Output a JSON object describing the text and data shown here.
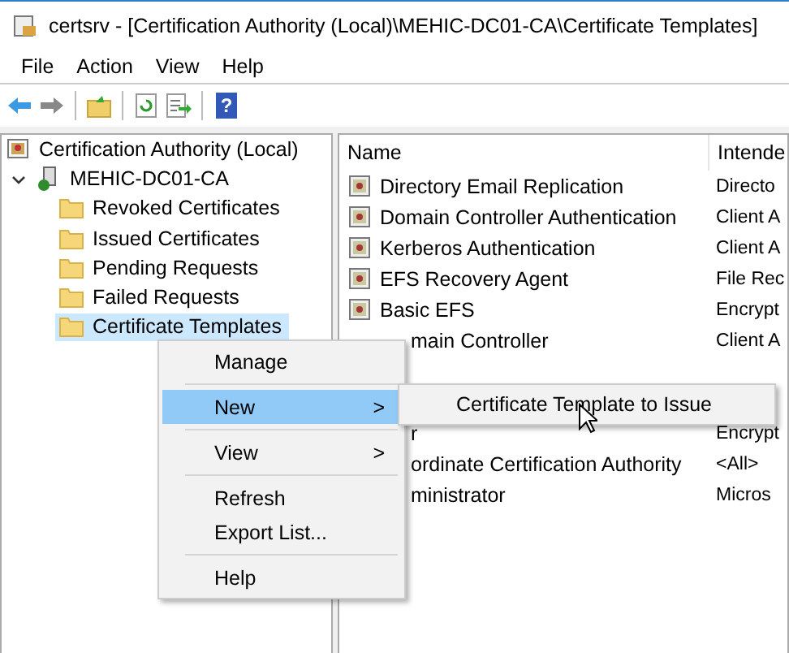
{
  "window": {
    "title": "certsrv - [Certification Authority (Local)\\MEHIC-DC01-CA\\Certificate Templates]"
  },
  "menu_bar": [
    "File",
    "Action",
    "View",
    "Help"
  ],
  "toolbar": {
    "help_glyph": "?"
  },
  "tree": [
    {
      "label": "Certification Authority (Local)",
      "kind": "root",
      "selected": false,
      "children": [
        {
          "label": "MEHIC-DC01-CA",
          "kind": "server",
          "selected": false,
          "expanded": true,
          "children": [
            {
              "label": "Revoked Certificates",
              "kind": "folder",
              "selected": false
            },
            {
              "label": "Issued Certificates",
              "kind": "folder",
              "selected": false
            },
            {
              "label": "Pending Requests",
              "kind": "folder",
              "selected": false
            },
            {
              "label": "Failed Requests",
              "kind": "folder",
              "selected": false
            },
            {
              "label": "Certificate Templates",
              "kind": "folder",
              "selected": true
            }
          ]
        }
      ]
    }
  ],
  "list": {
    "columns": [
      "Name",
      "Intende"
    ],
    "rows": [
      {
        "kind": "full",
        "name": "Directory Email Replication",
        "intended": "Directo"
      },
      {
        "kind": "full",
        "name": "Domain Controller Authentication",
        "intended": "Client A"
      },
      {
        "kind": "full",
        "name": "Kerberos Authentication",
        "intended": "Client A"
      },
      {
        "kind": "full",
        "name": "EFS Recovery Agent",
        "intended": "File Rec"
      },
      {
        "kind": "full",
        "name": "Basic EFS",
        "intended": "Encrypt"
      },
      {
        "kind": "covered",
        "name": "main Controller",
        "intended": "Client A"
      },
      {
        "kind": "gap"
      },
      {
        "kind": "gap"
      },
      {
        "kind": "covered",
        "name": "r",
        "intended": "Encrypt"
      },
      {
        "kind": "covered",
        "name": "ordinate Certification Authority",
        "intended": "<All>"
      },
      {
        "kind": "covered",
        "name": "ministrator",
        "intended": "Micros"
      }
    ]
  },
  "context_menu": {
    "items": [
      {
        "kind": "item",
        "label": "Manage",
        "selected": false,
        "submenu": false
      },
      {
        "kind": "separator"
      },
      {
        "kind": "item",
        "label": "New",
        "selected": true,
        "submenu": true,
        "arrow": ">"
      },
      {
        "kind": "separator"
      },
      {
        "kind": "item",
        "label": "View",
        "selected": false,
        "submenu": true,
        "arrow": ">"
      },
      {
        "kind": "separator"
      },
      {
        "kind": "item",
        "label": "Refresh",
        "selected": false,
        "submenu": false
      },
      {
        "kind": "item",
        "label": "Export List...",
        "selected": false,
        "submenu": false
      },
      {
        "kind": "separator"
      },
      {
        "kind": "item",
        "label": "Help",
        "selected": false,
        "submenu": false
      }
    ]
  },
  "submenu": {
    "items": [
      "Certificate Template to Issue"
    ]
  }
}
